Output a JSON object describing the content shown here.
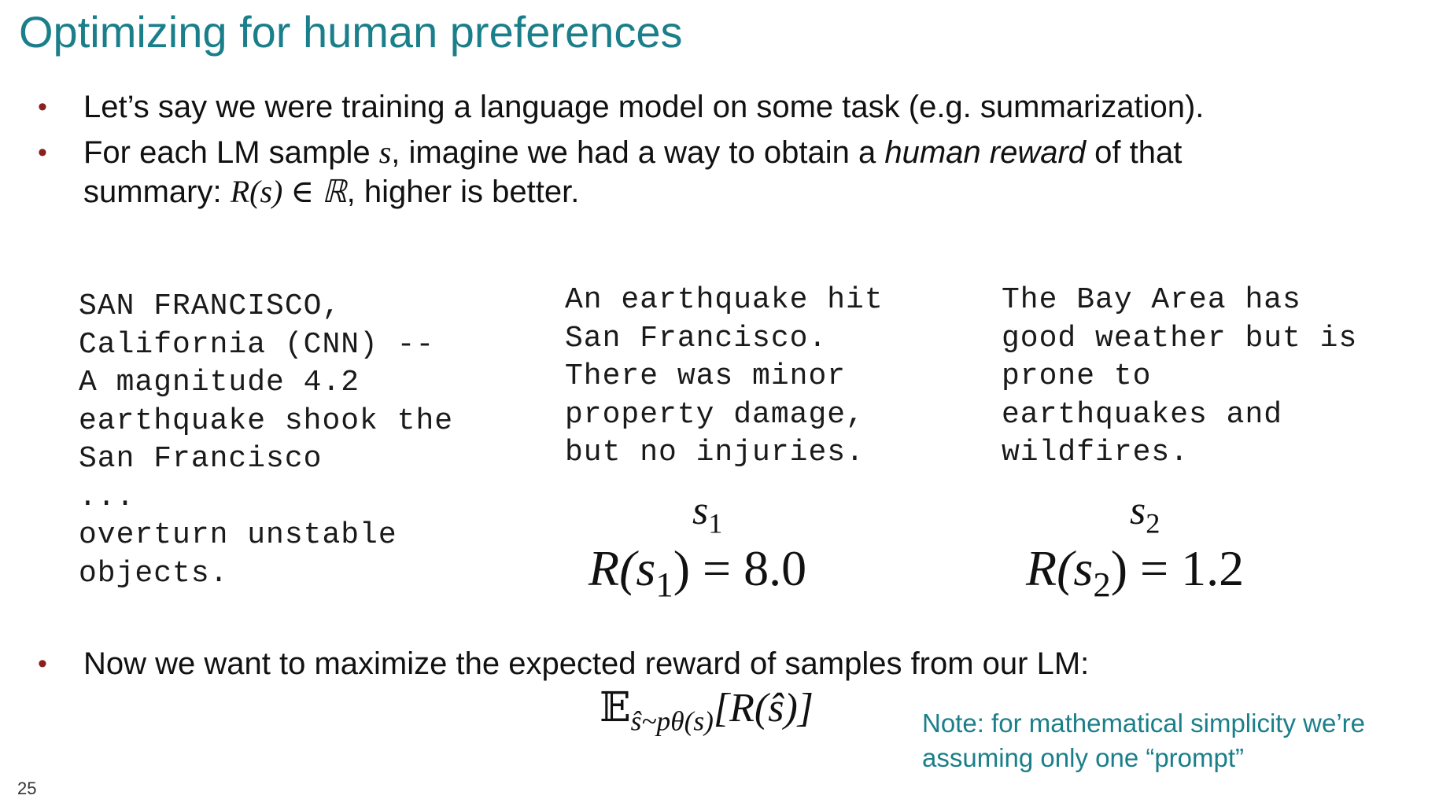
{
  "title": "Optimizing for human preferences",
  "bullets": [
    {
      "text": "Let’s say we were training a language model on some task (e.g. summarization)."
    },
    {
      "line1_before": "For each LM sample ",
      "line1_var": "s",
      "line1_middle": ", imagine we had a way to obtain a ",
      "line1_emph": "human reward",
      "line1_after": " of that",
      "line2_before": "summary: ",
      "line2_math": "R(s) ∈ ℝ",
      "line2_after": ", higher is better."
    },
    {
      "text": "Now we want to maximize the expected reward of samples from our LM:"
    }
  ],
  "article_text": "SAN FRANCISCO,\nCalifornia (CNN) --\nA magnitude 4.2\nearthquake shook the\nSan Francisco\n...\noverturn unstable\nobjects.",
  "samples": [
    {
      "text": "An earthquake hit\nSan Francisco.\nThere was minor\nproperty damage,\nbut no injuries.",
      "label_var": "s",
      "label_sub": "1",
      "reward_prefix": "R(",
      "reward_var": "s",
      "reward_sub": "1",
      "reward_suffix": ") = 8.0"
    },
    {
      "text": "The Bay Area has\ngood weather but is\nprone to\nearthquakes and\nwildfires.",
      "label_var": "s",
      "label_sub": "2",
      "reward_prefix": "R(",
      "reward_var": "s",
      "reward_sub": "2",
      "reward_suffix": ") = 1.2"
    }
  ],
  "expectation": {
    "operator": "𝔼",
    "subscript": "ŝ~pθ(s)",
    "body": "[R(ŝ)]"
  },
  "note": {
    "line1": "Note: for mathematical simplicity we’re",
    "line2": "assuming only one “prompt”"
  },
  "page_number": "25",
  "colors": {
    "title": "#1a7f8a",
    "bullet": "#8b2020",
    "note": "#1a7f8a"
  }
}
